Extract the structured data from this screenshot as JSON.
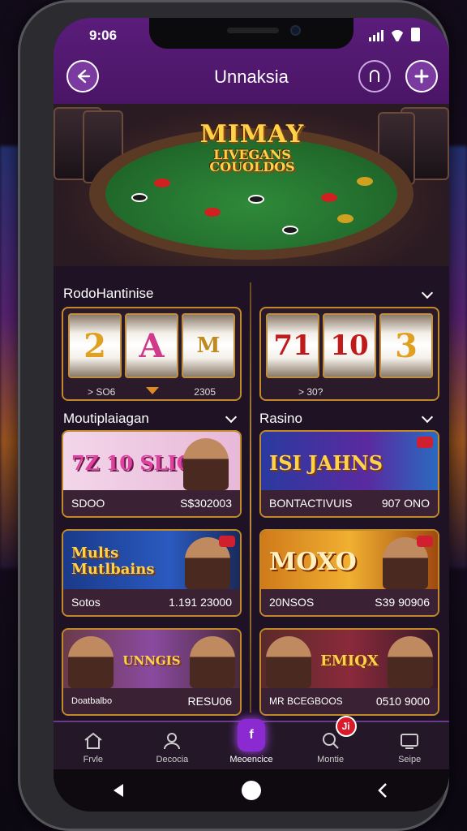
{
  "status": {
    "time": "9:06"
  },
  "header": {
    "title": "Unnaksia"
  },
  "hero": {
    "logo_line1": "MIMAY",
    "logo_line2": "LIVEGANS",
    "logo_line3": "COUOLDOS"
  },
  "sections": {
    "left_top": "RodoHantinise",
    "left_mid": "Moutiplaiagan",
    "right_mid": "Rasino"
  },
  "slots": [
    {
      "symbols": [
        "2",
        "A",
        "M"
      ],
      "caption_left": "> SO6",
      "caption_right": "2305"
    },
    {
      "symbols": [
        "71",
        "10",
        "3"
      ],
      "caption_left": "> 30?",
      "caption_right": ""
    }
  ],
  "cards": [
    {
      "banner": "7Z 10 SLIG",
      "left": "SDOO",
      "right": "S$302003"
    },
    {
      "banner": "ISI JAHNS",
      "left": "BONTACTIVUIS",
      "right": "907 ONO"
    },
    {
      "banner": "Mults Mutlbains",
      "left": "Sotos",
      "right": "1.191 23000"
    },
    {
      "banner": "MOXO",
      "left": "20NSOS",
      "right": "S39 90906"
    },
    {
      "banner": "UNNGIS",
      "left": "Doatbalbo",
      "right": "RESU06"
    },
    {
      "banner": "EMIQX",
      "left": "MR BCEGBOOS",
      "right": "0510 9000"
    }
  ],
  "bottom_nav": [
    {
      "label": "Frvle",
      "icon": "home-icon"
    },
    {
      "label": "Decocia",
      "icon": "user-icon"
    },
    {
      "label": "Meoencice",
      "icon": "active-tab-icon",
      "glyph": "f"
    },
    {
      "label": "Montie",
      "icon": "search-icon",
      "badge": "Ji"
    },
    {
      "label": "Seipe",
      "icon": "screen-icon"
    }
  ],
  "colors": {
    "header": "#5a1d7a",
    "accent": "#8a2ad0",
    "gold": "#c08a2a"
  }
}
